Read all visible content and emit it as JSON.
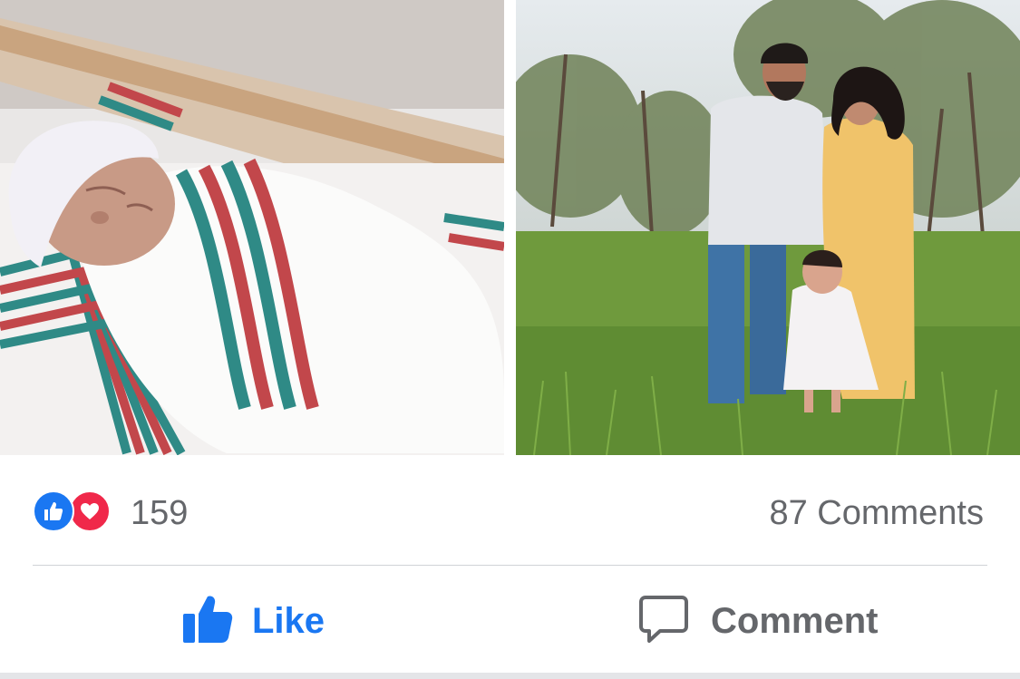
{
  "post": {
    "photos": [
      {
        "subject": "newborn-in-hospital-blanket"
      },
      {
        "subject": "family-portrait-outdoors"
      }
    ],
    "reactions": {
      "types": [
        "like",
        "love"
      ],
      "count": "159"
    },
    "comments_count_label": "87 Comments",
    "actions": {
      "like_label": "Like",
      "comment_label": "Comment"
    }
  },
  "colors": {
    "facebook_blue": "#1a77f2",
    "love_red": "#f0284a",
    "secondary_text": "#65676b"
  }
}
